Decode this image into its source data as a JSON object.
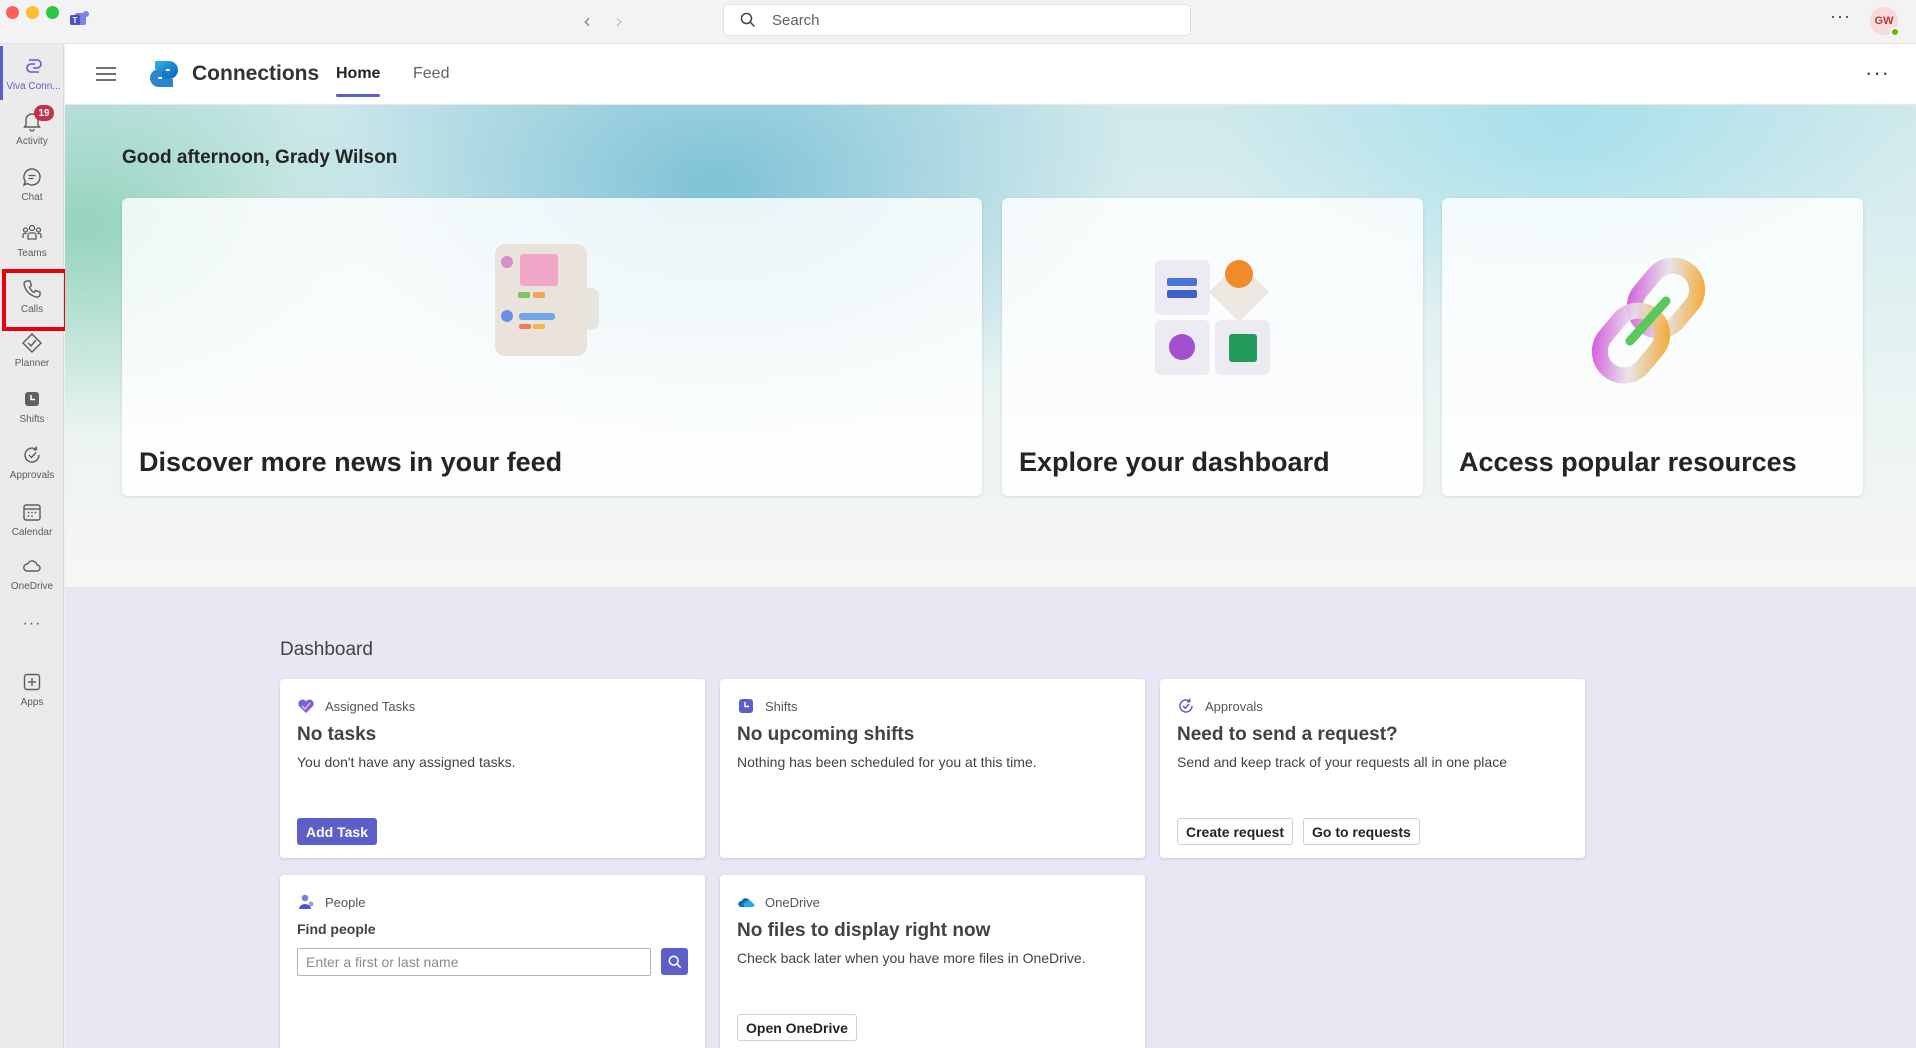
{
  "titlebar": {
    "search_placeholder": "Search",
    "avatar_initials": "GW",
    "more_label": "···"
  },
  "rail": {
    "items": [
      {
        "label": "Viva Conn...",
        "icon": "viva-connections-icon",
        "active": true
      },
      {
        "label": "Activity",
        "icon": "bell-icon",
        "badge": "19"
      },
      {
        "label": "Chat",
        "icon": "chat-icon"
      },
      {
        "label": "Teams",
        "icon": "teams-icon"
      },
      {
        "label": "Calls",
        "icon": "phone-icon"
      },
      {
        "label": "Planner",
        "icon": "planner-icon"
      },
      {
        "label": "Shifts",
        "icon": "shifts-icon"
      },
      {
        "label": "Approvals",
        "icon": "approvals-icon"
      },
      {
        "label": "Calendar",
        "icon": "calendar-icon"
      },
      {
        "label": "OneDrive",
        "icon": "cloud-icon"
      },
      {
        "label": "···",
        "icon": "more-icon"
      },
      {
        "label": "Apps",
        "icon": "add-apps-icon"
      }
    ]
  },
  "header": {
    "app_title": "Connections",
    "tabs": [
      {
        "label": "Home",
        "active": true
      },
      {
        "label": "Feed"
      }
    ],
    "more_label": "···"
  },
  "hero": {
    "greeting": "Good afternoon, Grady Wilson",
    "cards": [
      {
        "title": "Discover more news in your feed"
      },
      {
        "title": "Explore your dashboard"
      },
      {
        "title": "Access popular resources"
      }
    ]
  },
  "dashboard": {
    "title": "Dashboard",
    "cards": {
      "tasks": {
        "header": "Assigned Tasks",
        "title": "No tasks",
        "desc": "You don't have any assigned tasks.",
        "button": "Add Task"
      },
      "shifts": {
        "header": "Shifts",
        "title": "No upcoming shifts",
        "desc": "Nothing has been scheduled for you at this time."
      },
      "approvals": {
        "header": "Approvals",
        "title": "Need to send a request?",
        "desc": "Send and keep track of your requests all in one place",
        "button1": "Create request",
        "button2": "Go to requests"
      },
      "people": {
        "header": "People",
        "label": "Find people",
        "placeholder": "Enter a first or last name"
      },
      "onedrive": {
        "header": "OneDrive",
        "title": "No files to display right now",
        "desc": "Check back later when you have more files in OneDrive.",
        "button": "Open OneDrive"
      }
    }
  },
  "colors": {
    "accent": "#5b5fc7",
    "highlight": "#e8000a",
    "badge": "#c4314b"
  }
}
